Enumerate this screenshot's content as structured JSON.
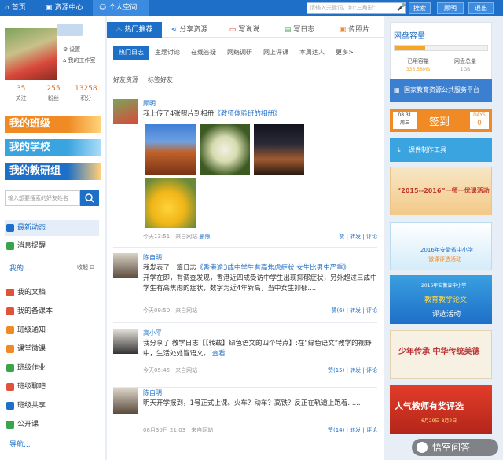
{
  "topbar": {
    "nav": [
      "首页",
      "资源中心",
      "个人空间"
    ],
    "search_placeholder": "请输入关键词，如“三角形”",
    "search_btn": "搜索",
    "user_btn": "顾明",
    "logout_btn": "退出"
  },
  "left": {
    "settings": "设置",
    "workroom": "我的工作室",
    "stats": [
      {
        "num": "35",
        "label": "关注"
      },
      {
        "num": "255",
        "label": "粉丝"
      },
      {
        "num": "13258",
        "label": "积分"
      }
    ],
    "banners": [
      "我的班级",
      "我的学校",
      "我的教研组"
    ],
    "search_placeholder": "输入想要搜索的好友姓名",
    "menu_top": [
      "最新动态",
      "消息提醒"
    ],
    "my_heading": "我的...",
    "collapse": "收起",
    "menu": [
      "我的文档",
      "我的备课本",
      "班级通知",
      "课堂微课",
      "班级作业",
      "班级聊吧",
      "班级共享",
      "公开课"
    ],
    "bottom_cut": "导航..."
  },
  "tabs": [
    "热门推荐",
    "分享资源",
    "写说说",
    "写日志",
    "传照片"
  ],
  "subtabs": [
    "热门日志",
    "主题讨论",
    "在线答疑",
    "网络调研",
    "网上评课",
    "本周达人",
    "更多>"
  ],
  "filters": [
    "好友资源",
    "标签好友"
  ],
  "posts": [
    {
      "name": "顾明",
      "text": "我上传了4张照片到相册",
      "link": "《教师体验班的相册》",
      "time": "今天13:51",
      "source": "来自网站",
      "extra": "删除",
      "acts": [
        "赞",
        "转发",
        "评论"
      ]
    },
    {
      "name": "陈自明",
      "text_prefix": "我发表了一篇日志",
      "link": "《香港逾3成中学生有高焦虑症状 女生比男生严重》",
      "body": "开学在即，有调查发现，香港近四成受访中学生出现抑郁症状，另外超过三成中学生有高焦虑的症状，数字为近4年新高，当中女生抑郁....",
      "time": "今天09:50",
      "source": "来自网站",
      "acts": [
        "赞(6)",
        "转发",
        "评论"
      ]
    },
    {
      "name": "高小平",
      "text": "我分享了 教学日志【【转载】绿色语文的四个特点】:在“绿色语文”教学的视野中，生活处处皆语文。",
      "link": "查看",
      "time": "今天05:45",
      "source": "来自网站",
      "acts": [
        "赞(15)",
        "转发",
        "评论"
      ]
    },
    {
      "name": "陈自明",
      "text": "明天开学报到，1号正式上课。火车？动车？高铁？反正在轨道上跑着......",
      "time": "08月30日 21:03",
      "source": "来自网站",
      "acts": [
        "赞(14)",
        "转发",
        "评论"
      ]
    }
  ],
  "right": {
    "disk_title": "网盘容量",
    "used_label": "已用容量",
    "used_val": "335.58MB",
    "total_label": "网盘总量",
    "total_val": "1GB",
    "disk_used_fraction": 0.33,
    "edu_platform": "国家教育资源公共服务平台",
    "sign_date": "08.31",
    "sign_weekday": "周三",
    "sign_label": "签到",
    "days_label": "DAYS",
    "days_count": "0",
    "courseware": "课件制作工具",
    "promo1": "“2015--2016”一师一优课活动",
    "promo2_line1": "2016年安徽省中小学",
    "promo2_line2": "微课评选活动",
    "promo3_line1": "2016年安徽省中小学",
    "promo3_line2": "教育教学论文",
    "promo3_line3": "评选活动",
    "promo4": "少年传承 中华传统美德",
    "promo5": "人气教师有奖评选",
    "promo5_date": "6月29日-8月2日",
    "watermark": "悟空问答"
  },
  "colors": {
    "brand": "#1e6fc7",
    "orange": "#f08a24",
    "topbar": "#1e6fc7"
  }
}
